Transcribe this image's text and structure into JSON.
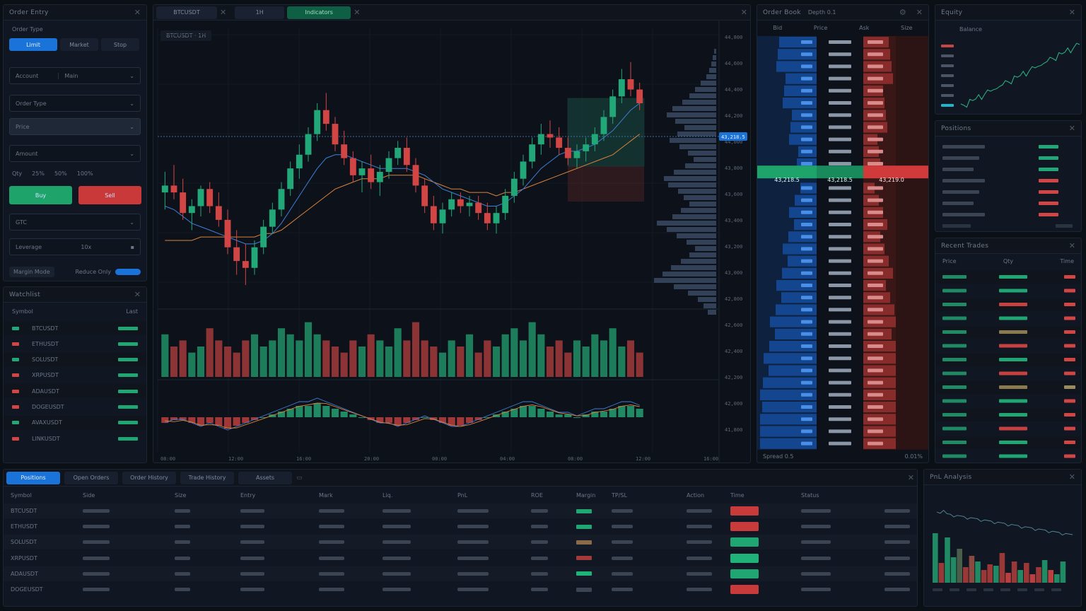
{
  "order_panel": {
    "title": "Order Entry",
    "tabs": [
      "Limit",
      "Market",
      "Stop"
    ],
    "account_label": "Account",
    "account_value": "Main",
    "type_label": "Order Type",
    "price_placeholder": "Price",
    "amount_label": "Amount",
    "qty_row": [
      "Qty",
      "25%",
      "50%",
      "100%"
    ],
    "buy_label": "Buy",
    "sell_label": "Sell",
    "tif_label": "GTC",
    "leverage_label": "Leverage",
    "leverage_value": "10x",
    "margin_label": "Margin Mode",
    "toggle_label": "Reduce Only"
  },
  "watchlist": {
    "title": "Watchlist",
    "header": [
      "Symbol",
      "Last"
    ],
    "rows": [
      {
        "sym": "BTCUSDT",
        "chg": "up"
      },
      {
        "sym": "ETHUSDT",
        "chg": "down"
      },
      {
        "sym": "SOLUSDT",
        "chg": "up"
      },
      {
        "sym": "XRPUSDT",
        "chg": "down"
      },
      {
        "sym": "ADAUSDT",
        "chg": "down"
      },
      {
        "sym": "DOGEUSDT",
        "chg": "down"
      },
      {
        "sym": "AVAXUSDT",
        "chg": "up"
      },
      {
        "sym": "LINKUSDT",
        "chg": "down"
      }
    ]
  },
  "chart_tabs": [
    "BTCUSDT",
    "1H",
    "Indicators"
  ],
  "chart_header": "BTCUSDT · 1H",
  "price_tag": "43,218.5",
  "chart_data": {
    "type": "candlestick",
    "candles": [
      [
        44,
        50,
        39,
        46
      ],
      [
        46,
        52,
        42,
        44
      ],
      [
        44,
        48,
        36,
        38
      ],
      [
        38,
        42,
        33,
        40
      ],
      [
        40,
        46,
        37,
        45
      ],
      [
        45,
        47,
        38,
        40
      ],
      [
        40,
        44,
        34,
        36
      ],
      [
        36,
        39,
        26,
        28
      ],
      [
        28,
        33,
        20,
        24
      ],
      [
        24,
        29,
        17,
        22
      ],
      [
        22,
        30,
        20,
        28
      ],
      [
        28,
        36,
        26,
        34
      ],
      [
        34,
        41,
        32,
        39
      ],
      [
        39,
        47,
        37,
        45
      ],
      [
        45,
        53,
        43,
        51
      ],
      [
        51,
        58,
        48,
        55
      ],
      [
        55,
        63,
        53,
        61
      ],
      [
        61,
        70,
        59,
        68
      ],
      [
        68,
        73,
        62,
        64
      ],
      [
        64,
        66,
        56,
        58
      ],
      [
        58,
        62,
        52,
        54
      ],
      [
        54,
        56,
        47,
        49
      ],
      [
        49,
        53,
        44,
        51
      ],
      [
        51,
        55,
        45,
        47
      ],
      [
        47,
        52,
        43,
        50
      ],
      [
        50,
        56,
        48,
        54
      ],
      [
        54,
        59,
        52,
        57
      ],
      [
        57,
        60,
        50,
        52
      ],
      [
        52,
        54,
        44,
        46
      ],
      [
        46,
        48,
        38,
        40
      ],
      [
        40,
        43,
        33,
        35
      ],
      [
        35,
        41,
        32,
        39
      ],
      [
        39,
        44,
        37,
        42
      ],
      [
        42,
        44,
        38,
        40
      ],
      [
        40,
        43,
        37,
        41
      ],
      [
        41,
        43,
        36,
        38
      ],
      [
        38,
        41,
        33,
        35
      ],
      [
        35,
        40,
        32,
        38
      ],
      [
        38,
        45,
        36,
        43
      ],
      [
        43,
        50,
        41,
        48
      ],
      [
        48,
        55,
        46,
        53
      ],
      [
        53,
        60,
        51,
        58
      ],
      [
        58,
        64,
        55,
        61
      ],
      [
        61,
        65,
        57,
        60
      ],
      [
        60,
        63,
        55,
        57
      ],
      [
        57,
        60,
        52,
        54
      ],
      [
        54,
        58,
        51,
        56
      ],
      [
        56,
        60,
        53,
        58
      ],
      [
        58,
        63,
        56,
        61
      ],
      [
        61,
        68,
        59,
        66
      ],
      [
        66,
        74,
        64,
        72
      ],
      [
        72,
        80,
        70,
        77
      ],
      [
        77,
        82,
        72,
        74
      ],
      [
        74,
        76,
        68,
        70
      ]
    ],
    "volume": [
      7,
      5,
      6,
      4,
      5,
      8,
      6,
      5,
      4,
      6,
      7,
      5,
      6,
      8,
      7,
      6,
      9,
      7,
      6,
      5,
      4,
      6,
      5,
      7,
      6,
      5,
      8,
      6,
      9,
      6,
      5,
      4,
      6,
      5,
      7,
      4,
      6,
      5,
      7,
      8,
      6,
      9,
      7,
      5,
      6,
      4,
      6,
      5,
      7,
      6,
      8,
      5,
      6,
      4
    ],
    "ma_fast": [
      40,
      39,
      37,
      35,
      34,
      33,
      32,
      31,
      30,
      29,
      29,
      30,
      32,
      35,
      39,
      43,
      47,
      51,
      54,
      55,
      55,
      54,
      53,
      52,
      51,
      51,
      51,
      51,
      50,
      49,
      47,
      45,
      44,
      43,
      42,
      41,
      40,
      40,
      41,
      43,
      45,
      48,
      51,
      53,
      55,
      56,
      56,
      57,
      58,
      60,
      62,
      65,
      68,
      70
    ],
    "ma_slow": [
      30,
      30,
      30,
      30,
      31,
      31,
      31,
      31,
      31,
      31,
      31,
      32,
      32,
      33,
      35,
      37,
      39,
      41,
      43,
      45,
      46,
      47,
      48,
      48,
      48,
      49,
      49,
      49,
      49,
      48,
      47,
      46,
      45,
      45,
      44,
      44,
      44,
      43,
      44,
      44,
      45,
      46,
      47,
      48,
      49,
      50,
      51,
      52,
      53,
      54,
      55,
      57,
      59,
      61
    ],
    "macd_hist": [
      -2,
      -1,
      -1,
      -2,
      -3,
      -2,
      -3,
      -4,
      -3,
      -2,
      -1,
      0,
      1,
      2,
      3,
      4,
      4,
      5,
      4,
      3,
      2,
      1,
      0,
      -1,
      -2,
      -2,
      -3,
      -2,
      -1,
      0,
      -1,
      -2,
      -3,
      -3,
      -2,
      -1,
      0,
      1,
      2,
      3,
      4,
      4,
      3,
      2,
      1,
      1,
      0,
      1,
      2,
      2,
      3,
      4,
      4,
      3
    ]
  },
  "time_labels": [
    "08:00",
    "12:00",
    "16:00",
    "20:00",
    "00:00",
    "04:00",
    "08:00",
    "12:00",
    "16:00"
  ],
  "price_levels": [
    "44,800",
    "44,600",
    "44,400",
    "44,200",
    "44,000",
    "43,800",
    "43,600",
    "43,400",
    "43,200",
    "43,000",
    "42,800",
    "42,600",
    "42,400",
    "42,200",
    "42,000",
    "41,800"
  ],
  "orderbook": {
    "title": "Order Book",
    "subtitle": "Depth 0.1",
    "header": [
      "Bid",
      "Price",
      "Ask",
      "Size"
    ],
    "mid_bid": "43,218.5",
    "mid_price": "43,218.5",
    "mid_ask": "43,219.0",
    "footer_left": "Spread 0.5",
    "footer_right": "0.01%"
  },
  "mini_chart": {
    "title": "Equity",
    "subtitle": "Balance"
  },
  "positions_mini": {
    "title": "Positions"
  },
  "trades": {
    "title": "Recent Trades",
    "header": [
      "Price",
      "Qty",
      "Time"
    ]
  },
  "bottom_tabs": [
    "Positions",
    "Open Orders",
    "Order History",
    "Trade History",
    "Assets"
  ],
  "table": {
    "columns": [
      "Symbol",
      "Side",
      "Size",
      "Entry",
      "Mark",
      "Liq.",
      "PnL",
      "ROE",
      "Margin",
      "TP/SL",
      "Action",
      "Time",
      "Status"
    ],
    "rows": [
      {
        "sym": "BTCUSDT",
        "badge": "#1fa672",
        "action": "#c93a3a"
      },
      {
        "sym": "ETHUSDT",
        "badge": "#1fa672",
        "action": "#c93a3a"
      },
      {
        "sym": "SOLUSDT",
        "badge": "#8a6a48",
        "action": "#1fa672"
      },
      {
        "sym": "XRPUSDT",
        "badge": "#a33a3a",
        "action": "#1fb37a"
      },
      {
        "sym": "ADAUSDT",
        "badge": "#1fb37a",
        "action": "#1fa672"
      },
      {
        "sym": "DOGEUSDT",
        "badge": "#3a4453",
        "action": "#c93a3a"
      }
    ]
  },
  "stats_panel": {
    "title": "PnL Analysis"
  },
  "colors": {
    "up": "#22a878",
    "down": "#d24545",
    "accent": "#1a73d9",
    "bg": "#0b0f16"
  }
}
